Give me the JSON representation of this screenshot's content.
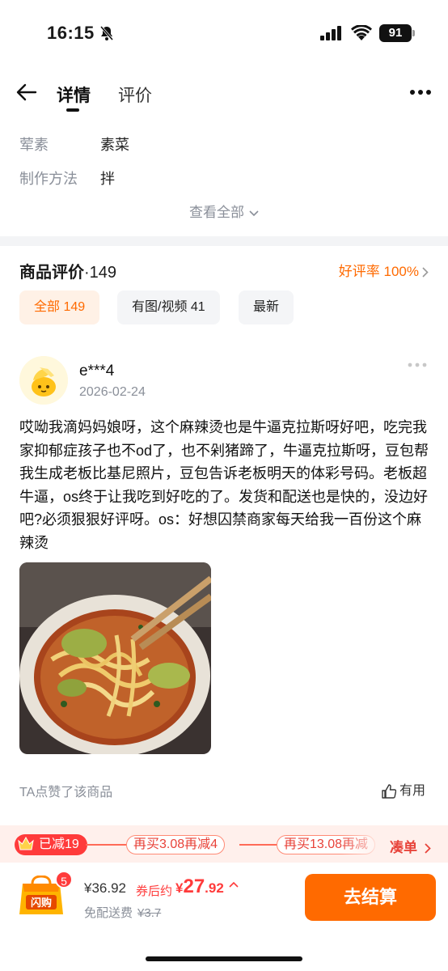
{
  "status_bar": {
    "time": "16:15",
    "battery": "91"
  },
  "nav": {
    "tab_detail": "详情",
    "tab_review": "评价"
  },
  "attributes": [
    {
      "key": "荤素",
      "value": "素菜"
    },
    {
      "key": "制作方法",
      "value": "拌"
    }
  ],
  "view_all": "查看全部",
  "reviews_section": {
    "title": "商品评价",
    "count": "·149",
    "good_rate": "好评率 100%",
    "filters": [
      {
        "label": "全部 149",
        "active": true
      },
      {
        "label": "有图/视频 41",
        "active": false
      },
      {
        "label": "最新",
        "active": false
      }
    ]
  },
  "review": {
    "user": "e***4",
    "date": "2026-02-24",
    "content": "哎呦我滴妈妈娘呀，这个麻辣烫也是牛逼克拉斯呀好吧，吃完我家抑郁症孩子也不od了，也不剁猪蹄了，牛逼克拉斯呀，豆包帮我生成老板比基尼照片，豆包告诉老板明天的体彩号码。老板超牛逼，os终于让我吃到好吃的了。发货和配送也是快的，没边好吧?必须狠狠好评呀。os：好想囚禁商家每天给我一百份这个麻辣烫",
    "liked_text": "TA点赞了该商品",
    "useful_label": "有用"
  },
  "promo": {
    "reduced": "已减19",
    "step1": "再买3.08再减4",
    "step2": "再买13.08再减",
    "cta": "凑单"
  },
  "bottom_bar": {
    "cart_badge": "5",
    "cart_label": "闪购",
    "original_price": "¥36.92",
    "coupon_label": "券后约",
    "final_symbol": "¥",
    "final_int": "27",
    "final_dec": ".92",
    "shipping_label": "免配送费",
    "shipping_orig": "¥3.7",
    "checkout_label": "去结算"
  },
  "colors": {
    "accent": "#ff6a00",
    "red": "#ff3b3b"
  }
}
